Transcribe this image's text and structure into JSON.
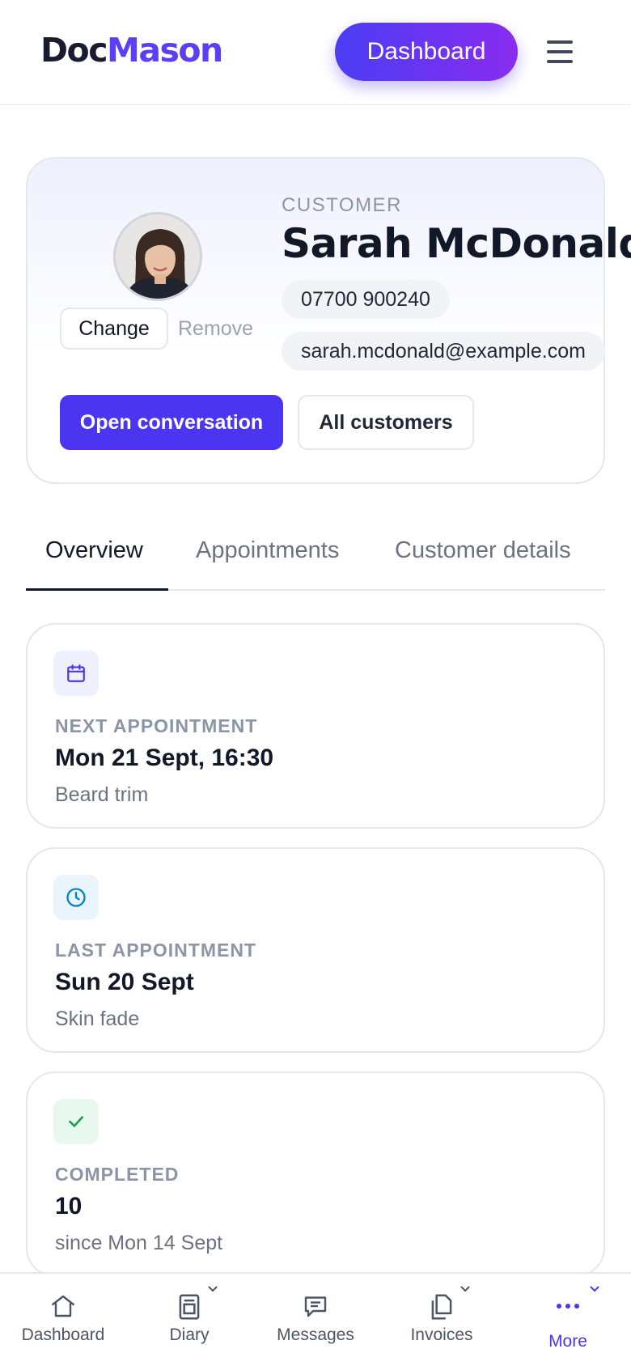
{
  "header": {
    "logo_part1": "Doc",
    "logo_part2": "Mason",
    "dashboard_label": "Dashboard",
    "menu_icon": "hamburger-menu-icon"
  },
  "profile": {
    "label": "CUSTOMER",
    "name": "Sarah McDonald",
    "phone": "07700 900240",
    "email": "sarah.mcdonald@example.com",
    "change_label": "Change",
    "remove_label": "Remove",
    "open_conversation_label": "Open conversation",
    "all_customers_label": "All customers"
  },
  "tabs": [
    {
      "label": "Overview",
      "active": true
    },
    {
      "label": "Appointments",
      "active": false
    },
    {
      "label": "Customer details",
      "active": false
    }
  ],
  "stats": [
    {
      "icon": "calendar-icon",
      "label": "NEXT APPOINTMENT",
      "value": "Mon 21 Sept, 16:30",
      "sub": "Beard trim"
    },
    {
      "icon": "clock-icon",
      "label": "LAST APPOINTMENT",
      "value": "Sun 20 Sept",
      "sub": "Skin fade"
    },
    {
      "icon": "check-icon",
      "label": "COMPLETED",
      "value": "10",
      "sub": "since Mon 14 Sept"
    }
  ],
  "bottom_nav": [
    {
      "label": "Dashboard",
      "icon": "home-icon"
    },
    {
      "label": "Diary",
      "icon": "diary-icon"
    },
    {
      "label": "Messages",
      "icon": "message-icon"
    },
    {
      "label": "Invoices",
      "icon": "invoice-icon"
    },
    {
      "label": "More",
      "icon": "more-dots-icon",
      "active": true
    }
  ],
  "colors": {
    "brand": "#4b35f0",
    "brand_gradient_end": "#8a2cf0",
    "text": "#111827",
    "muted": "#6b7280"
  }
}
